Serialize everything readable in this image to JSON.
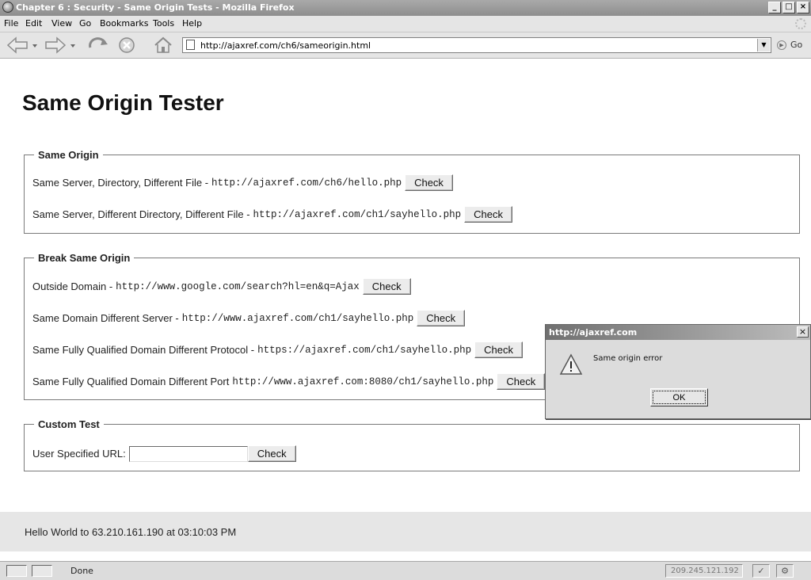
{
  "window": {
    "title": "Chapter 6 : Security - Same Origin Tests - Mozilla Firefox",
    "controls": {
      "minimize": "_",
      "maximize": "□",
      "close": "×"
    }
  },
  "menu": [
    "File",
    "Edit",
    "View",
    "Go",
    "Bookmarks",
    "Tools",
    "Help"
  ],
  "nav": {
    "url": "http://ajaxref.com/ch6/sameorigin.html",
    "go_label": "Go"
  },
  "page": {
    "title": "Same Origin Tester",
    "same_origin": {
      "legend": "Same Origin",
      "rows": [
        {
          "label": "Same Server, Directory, Different File -",
          "url": "http://ajaxref.com/ch6/hello.php",
          "button": "Check"
        },
        {
          "label": "Same Server, Different Directory, Different File -",
          "url": "http://ajaxref.com/ch1/sayhello.php",
          "button": "Check"
        }
      ]
    },
    "break_origin": {
      "legend": "Break Same Origin",
      "rows": [
        {
          "label": "Outside Domain -",
          "url": "http://www.google.com/search?hl=en&q=Ajax",
          "button": "Check"
        },
        {
          "label": "Same Domain Different Server -",
          "url": "http://www.ajaxref.com/ch1/sayhello.php",
          "button": "Check"
        },
        {
          "label": "Same Fully Qualified Domain Different Protocol -",
          "url": "https://ajaxref.com/ch1/sayhello.php",
          "button": "Check"
        },
        {
          "label": "Same Fully Qualified Domain Different Port",
          "url": "http://www.ajaxref.com:8080/ch1/sayhello.php",
          "button": "Check"
        }
      ]
    },
    "custom": {
      "legend": "Custom Test",
      "label": "User Specified URL:",
      "input_value": "",
      "button": "Check"
    },
    "footer": "Hello World to 63.210.161.190 at 03:10:03 PM"
  },
  "dialog": {
    "title": "http://ajaxref.com",
    "message": "Same origin error",
    "ok": "OK",
    "close": "×"
  },
  "status": {
    "text": "Done",
    "ip": "209.245.121.192"
  }
}
